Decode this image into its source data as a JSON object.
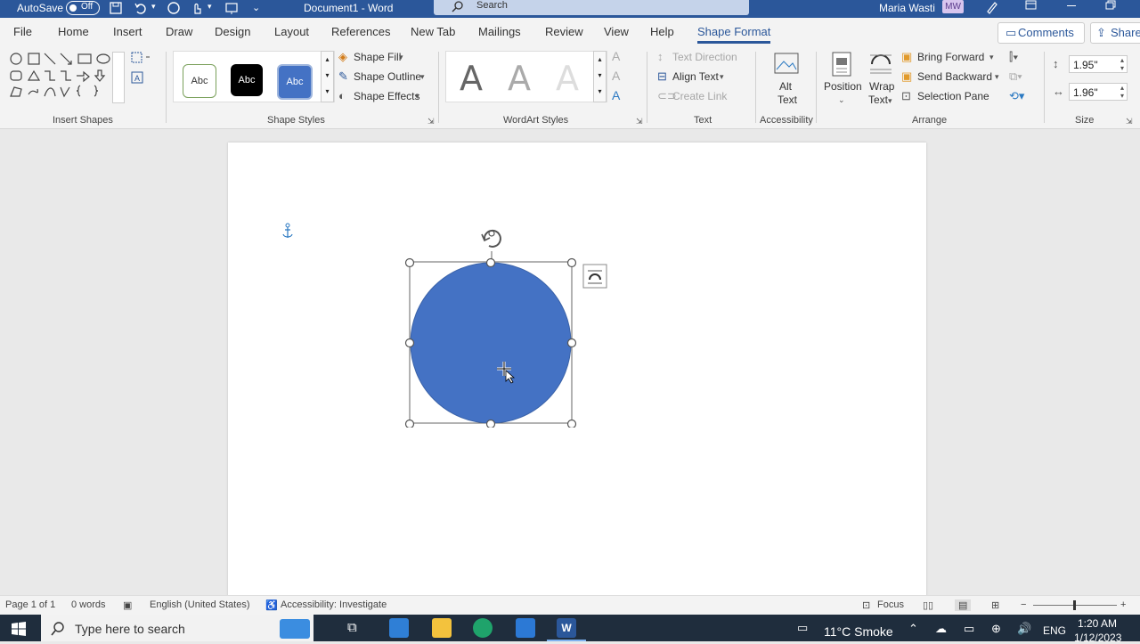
{
  "titlebar": {
    "autosave_label": "AutoSave",
    "autosave_state": "Off",
    "doc_title": "Document1 - Word",
    "search_placeholder": "Search",
    "user_name": "Maria Wasti",
    "user_initials": "MW"
  },
  "menu": {
    "tabs": [
      "File",
      "Home",
      "Insert",
      "Draw",
      "Design",
      "Layout",
      "References",
      "New Tab",
      "Mailings",
      "Review",
      "View",
      "Help",
      "Shape Format"
    ],
    "active_tab": "Shape Format",
    "comments_label": "Comments",
    "share_label": "Share"
  },
  "ribbon": {
    "groups": {
      "insert_shapes": "Insert Shapes",
      "shape_styles": "Shape Styles",
      "wordart_styles": "WordArt Styles",
      "text": "Text",
      "accessibility": "Accessibility",
      "arrange": "Arrange",
      "size": "Size"
    },
    "style_presets": [
      "Abc",
      "Abc",
      "Abc"
    ],
    "shape_fill": "Shape Fill",
    "shape_outline": "Shape Outline",
    "shape_effects": "Shape Effects",
    "wordart_glyph": "A",
    "text_direction": "Text Direction",
    "align_text": "Align Text",
    "create_link": "Create Link",
    "alt_text_line1": "Alt",
    "alt_text_line2": "Text",
    "position": "Position",
    "wrap_text_line1": "Wrap",
    "wrap_text_line2": "Text",
    "bring_forward": "Bring Forward",
    "send_backward": "Send Backward",
    "selection_pane": "Selection Pane",
    "height": "1.95\"",
    "width": "1.96\""
  },
  "statusbar": {
    "page": "Page 1 of 1",
    "words": "0 words",
    "language": "English (United States)",
    "accessibility": "Accessibility: Investigate",
    "focus": "Focus"
  },
  "taskbar": {
    "search_placeholder": "Type here to search",
    "weather": "11°C  Smoke",
    "lang": "ENG",
    "time": "1:20 AM",
    "date": "1/12/2023"
  },
  "colors": {
    "word_blue": "#2b579a",
    "shape_fill": "#4472c4"
  }
}
